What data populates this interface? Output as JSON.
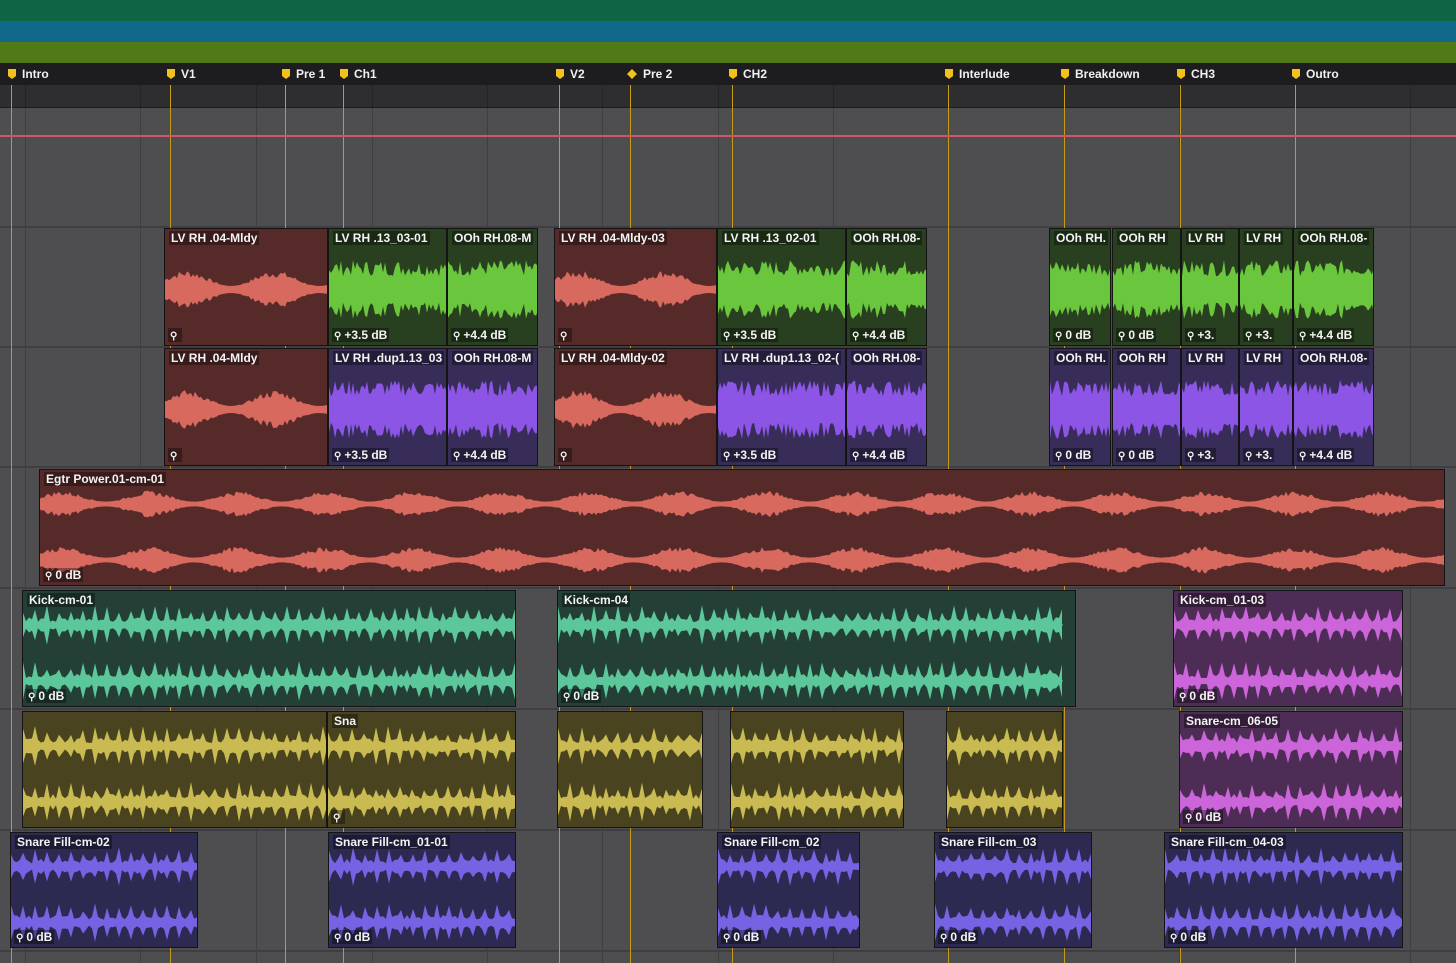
{
  "colors": {
    "band_top": "#0e6445",
    "band_mid": "#11698a",
    "band_low": "#4f7a16",
    "marker": "#f2c21a",
    "red_clip": "#572a2a",
    "red_wave": "#d7695e",
    "green_clip": "#283f20",
    "green_wave": "#6ac63c",
    "violet_clip": "#372d58",
    "violet_wave": "#8c55e6",
    "teal_clip": "#243f36",
    "teal_wave": "#5cc79b",
    "magenta_clip": "#4d2c55",
    "magenta_wave": "#cc65da",
    "yellow_clip": "#49431f",
    "yellow_wave": "#c9bb52",
    "navy_clip": "#2c2a50",
    "navy_wave": "#7563e3"
  },
  "markers": [
    {
      "label": "Intro",
      "icon": "marker-flag-icon"
    },
    {
      "label": "V1",
      "icon": "marker-flag-icon"
    },
    {
      "label": "Pre 1",
      "icon": "marker-flag-icon"
    },
    {
      "label": "Ch1",
      "icon": "marker-flag-icon"
    },
    {
      "label": "V2",
      "icon": "marker-flag-icon"
    },
    {
      "label": "Pre 2",
      "icon": "marker-diamond-icon"
    },
    {
      "label": "CH2",
      "icon": "marker-flag-icon"
    },
    {
      "label": "Interlude",
      "icon": "marker-flag-icon"
    },
    {
      "label": "Breakdown",
      "icon": "marker-flag-icon"
    },
    {
      "label": "CH3",
      "icon": "marker-flag-icon"
    },
    {
      "label": "Outro",
      "icon": "marker-flag-icon"
    }
  ],
  "tracks": {
    "vocal_a": [
      {
        "name": "LV RH .04-Mldy",
        "gain": ""
      },
      {
        "name": "LV RH .13_03-01",
        "gain": "+3.5 dB"
      },
      {
        "name": "OOh RH.08-M",
        "gain": "+4.4 dB"
      },
      {
        "name": "LV RH .04-Mldy-03",
        "gain": ""
      },
      {
        "name": "LV RH .13_02-01",
        "gain": "+3.5 dB"
      },
      {
        "name": "OOh RH.08-",
        "gain": "+4.4 dB"
      },
      {
        "name": "OOh RH.",
        "gain": "0 dB"
      },
      {
        "name": "OOh RH",
        "gain": "0 dB"
      },
      {
        "name": "LV RH",
        "gain": "+3."
      },
      {
        "name": "LV RH",
        "gain": "+3."
      },
      {
        "name": "OOh RH.08-",
        "gain": "+4.4 dB"
      }
    ],
    "vocal_b": [
      {
        "name": "LV RH .04-Mldy",
        "gain": ""
      },
      {
        "name": "LV RH .dup1.13_03",
        "gain": "+3.5 dB"
      },
      {
        "name": "OOh RH.08-M",
        "gain": "+4.4 dB"
      },
      {
        "name": "LV RH .04-Mldy-02",
        "gain": ""
      },
      {
        "name": "LV RH .dup1.13_02-(",
        "gain": "+3.5 dB"
      },
      {
        "name": "OOh RH.08-",
        "gain": "+4.4 dB"
      },
      {
        "name": "OOh RH.",
        "gain": "0 dB"
      },
      {
        "name": "OOh RH",
        "gain": "0 dB"
      },
      {
        "name": "LV RH",
        "gain": "+3."
      },
      {
        "name": "LV RH",
        "gain": "+3."
      },
      {
        "name": "OOh RH.08-",
        "gain": "+4.4 dB"
      }
    ],
    "guitar": [
      {
        "name": "Egtr Power.01-cm-01",
        "gain": "0 dB"
      }
    ],
    "kick": [
      {
        "name": "Kick-cm-01",
        "gain": "0 dB"
      },
      {
        "name": "Kick-cm-04",
        "gain": "0 dB"
      },
      {
        "name": "Kick-cm_01-03",
        "gain": "0 dB"
      }
    ],
    "snare": [
      {
        "name": "",
        "gain": ""
      },
      {
        "name": "Sna",
        "gain": ""
      },
      {
        "name": "",
        "gain": ""
      },
      {
        "name": "",
        "gain": ""
      },
      {
        "name": "",
        "gain": ""
      },
      {
        "name": "",
        "gain": ""
      },
      {
        "name": "Snare-cm_06-05",
        "gain": "0 dB"
      }
    ],
    "snare_fill": [
      {
        "name": "Snare Fill-cm-02",
        "gain": "0 dB"
      },
      {
        "name": "Snare Fill-cm_01-01",
        "gain": "0 dB"
      },
      {
        "name": "Snare Fill-cm_02",
        "gain": "0 dB"
      },
      {
        "name": "Snare Fill-cm_03",
        "gain": "0 dB"
      },
      {
        "name": "Snare Fill-cm_04-03",
        "gain": "0 dB"
      }
    ]
  }
}
